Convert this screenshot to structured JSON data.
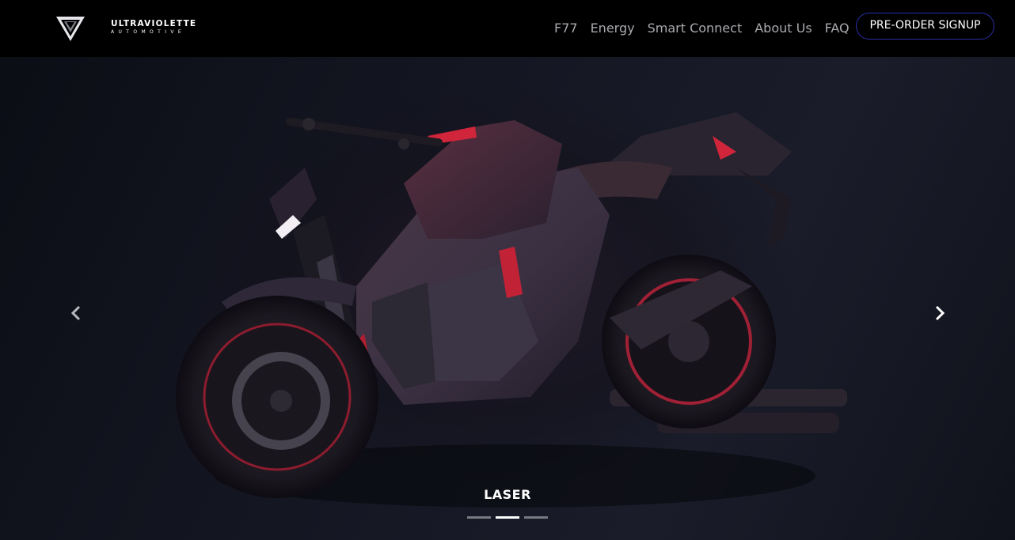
{
  "brand": {
    "line1": "ULTRAVIOLETTE",
    "line2": "AUTOMOTIVE"
  },
  "nav": {
    "items": [
      {
        "label": "F77"
      },
      {
        "label": "Energy"
      },
      {
        "label": "Smart Connect"
      },
      {
        "label": "About Us"
      },
      {
        "label": "FAQ"
      }
    ],
    "cta_label": "PRE-ORDER SIGNUP"
  },
  "hero": {
    "slide_caption": "LASER",
    "slides_total": 3,
    "active_slide": 2
  },
  "colors": {
    "nav_bg": "#000000",
    "accent_border": "#2b2fa8",
    "bike_red_accent": "#d0253b"
  }
}
